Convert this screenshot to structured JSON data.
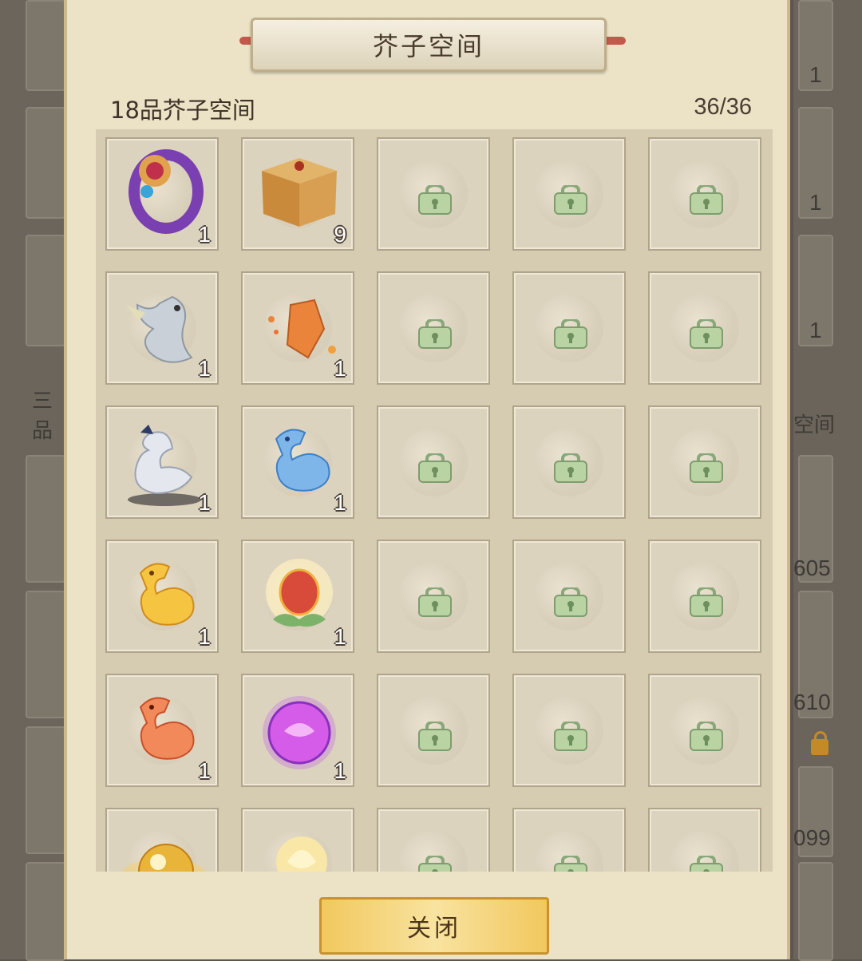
{
  "dialog": {
    "title": "芥子空间",
    "subtitle": "18品芥子空间",
    "capacity": "36/36",
    "close_label": "关闭"
  },
  "background": {
    "left_label": "三品",
    "right_label": "空间",
    "right_counts": [
      "1",
      "1",
      "1",
      "605",
      "610",
      "099"
    ]
  },
  "slots": [
    {
      "icon": "purple-ring-icon",
      "qty": "1"
    },
    {
      "icon": "golden-chest-icon",
      "qty": "9"
    },
    {
      "icon": "locked-slot-icon",
      "qty": ""
    },
    {
      "icon": "locked-slot-icon",
      "qty": ""
    },
    {
      "icon": "locked-slot-icon",
      "qty": ""
    },
    {
      "icon": "silver-dragon-icon",
      "qty": "1"
    },
    {
      "icon": "orange-crystal-icon",
      "qty": "1"
    },
    {
      "icon": "locked-slot-icon",
      "qty": ""
    },
    {
      "icon": "locked-slot-icon",
      "qty": ""
    },
    {
      "icon": "locked-slot-icon",
      "qty": ""
    },
    {
      "icon": "white-dragon-statue-icon",
      "qty": "1"
    },
    {
      "icon": "blue-spirit-horse-icon",
      "qty": "1"
    },
    {
      "icon": "locked-slot-icon",
      "qty": ""
    },
    {
      "icon": "locked-slot-icon",
      "qty": ""
    },
    {
      "icon": "locked-slot-icon",
      "qty": ""
    },
    {
      "icon": "gold-spirit-horse-icon",
      "qty": "1"
    },
    {
      "icon": "lotus-egg-icon",
      "qty": "1"
    },
    {
      "icon": "locked-slot-icon",
      "qty": ""
    },
    {
      "icon": "locked-slot-icon",
      "qty": ""
    },
    {
      "icon": "locked-slot-icon",
      "qty": ""
    },
    {
      "icon": "red-spirit-horse-icon",
      "qty": "1"
    },
    {
      "icon": "purple-orb-icon",
      "qty": "1"
    },
    {
      "icon": "locked-slot-icon",
      "qty": ""
    },
    {
      "icon": "locked-slot-icon",
      "qty": ""
    },
    {
      "icon": "locked-slot-icon",
      "qty": ""
    },
    {
      "icon": "golden-pearl-icon",
      "qty": ""
    },
    {
      "icon": "lotus-flower-icon",
      "qty": ""
    },
    {
      "icon": "locked-slot-icon",
      "qty": ""
    },
    {
      "icon": "locked-slot-icon",
      "qty": ""
    },
    {
      "icon": "locked-slot-icon",
      "qty": ""
    }
  ]
}
